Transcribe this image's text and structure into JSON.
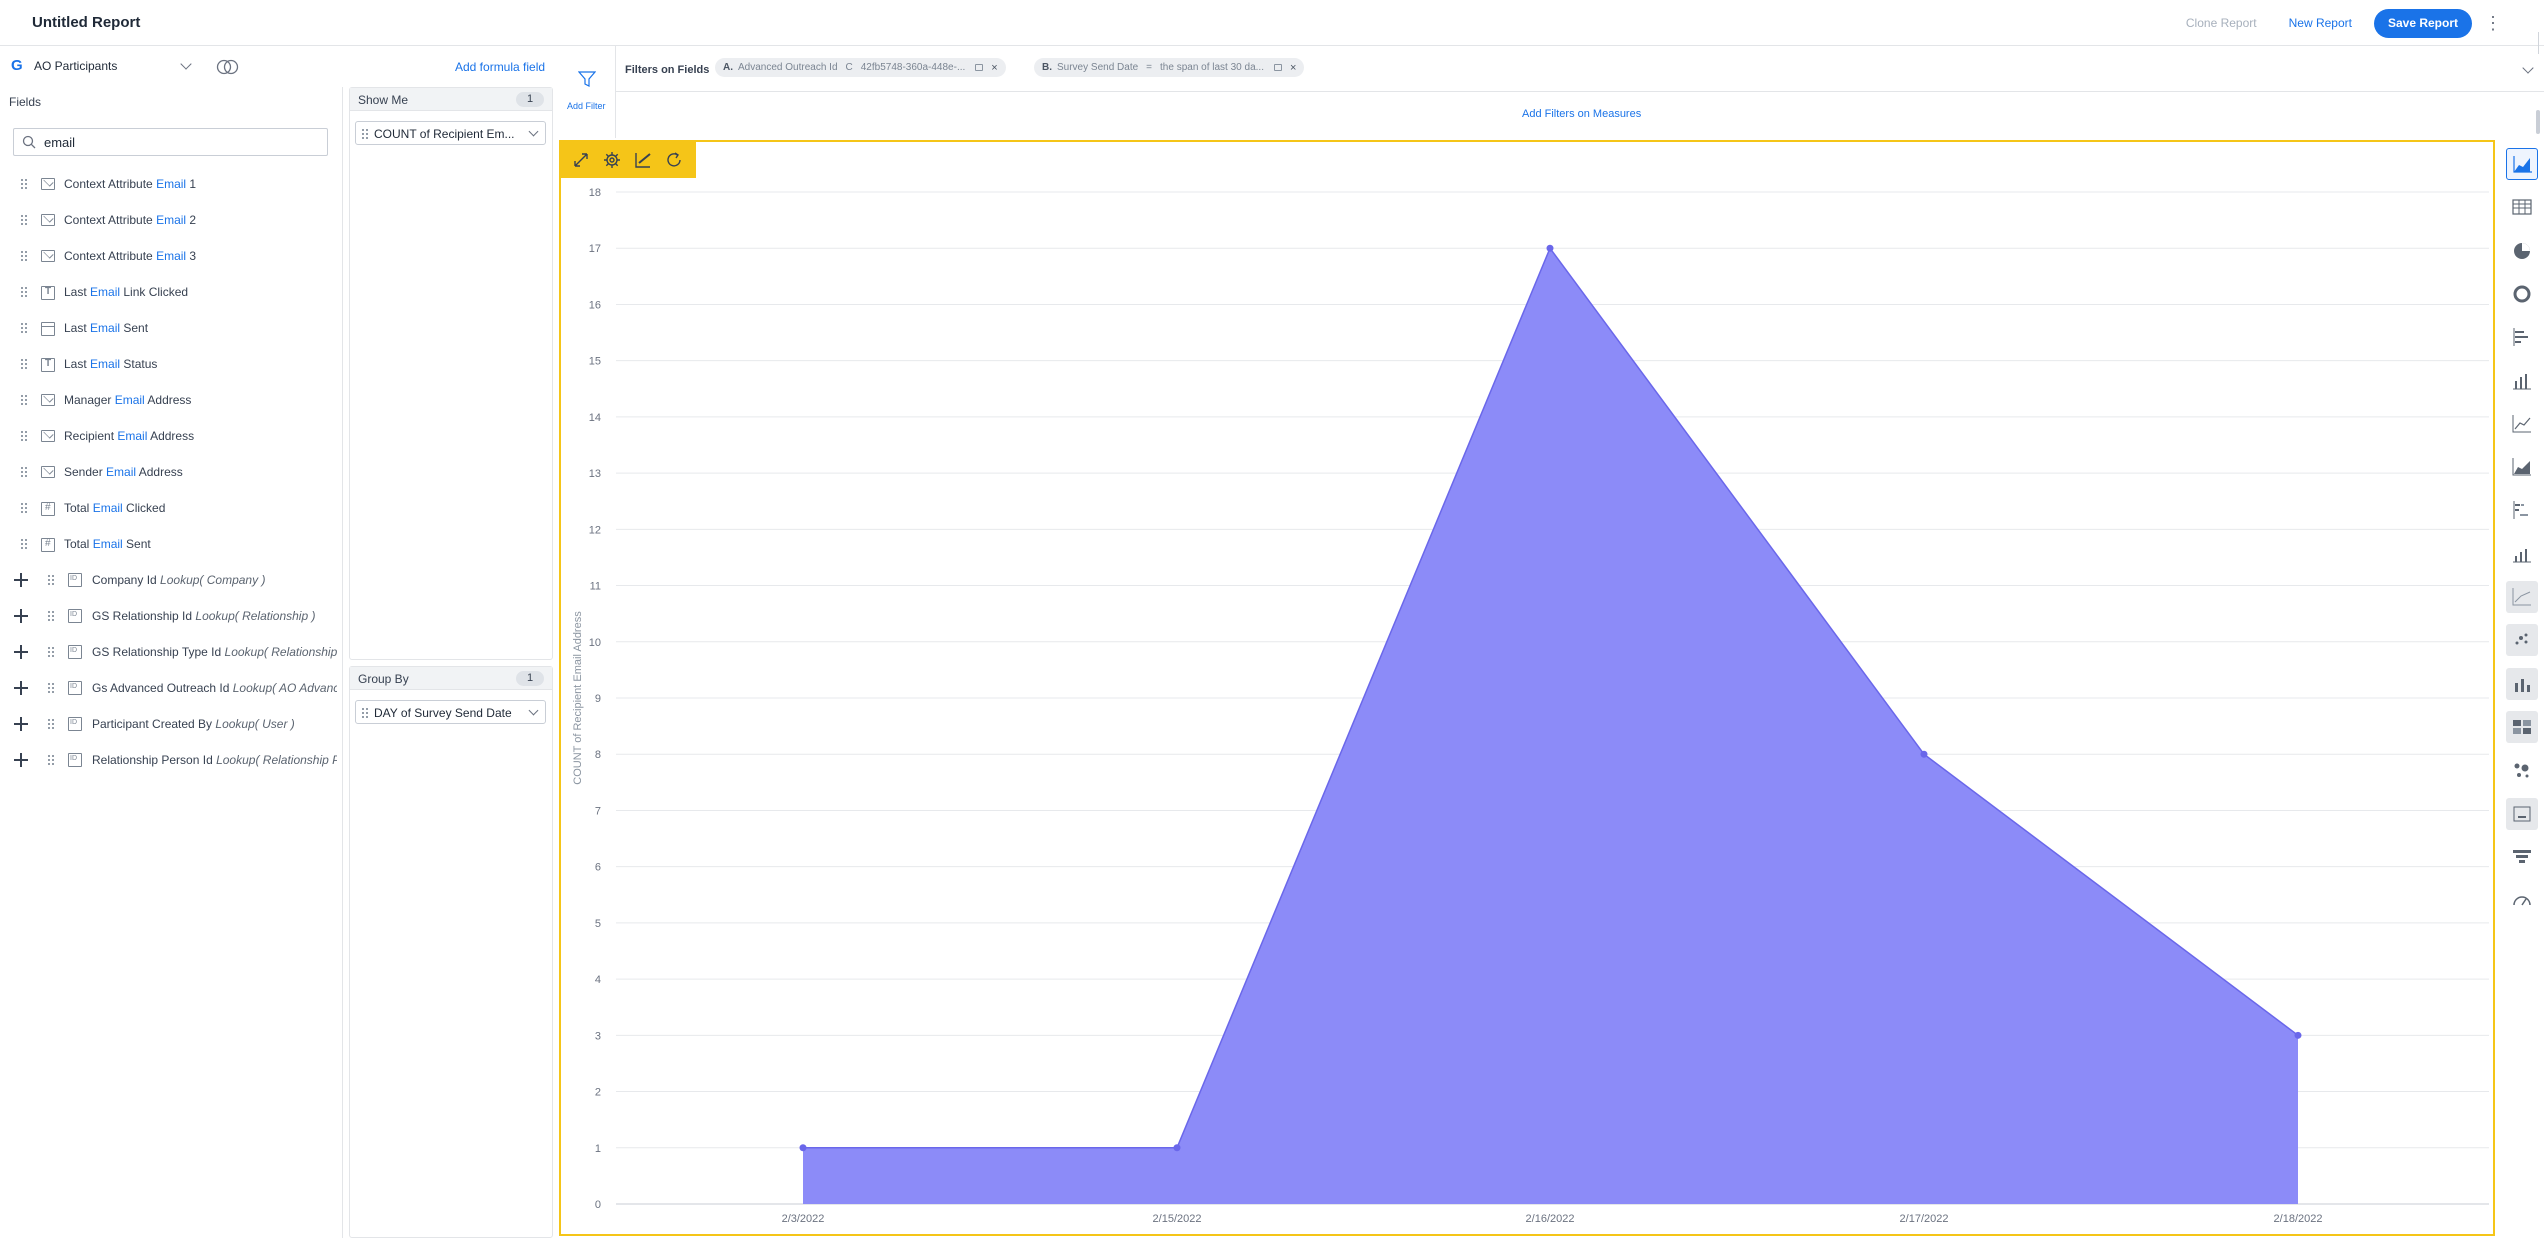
{
  "header": {
    "title": "Untitled Report",
    "clone_label": "Clone Report",
    "new_label": "New Report",
    "save_label": "Save Report"
  },
  "source": {
    "logo": "G",
    "object": "AO Participants",
    "add_formula_label": "Add formula field"
  },
  "fields_panel": {
    "header": "Fields",
    "search_value": "email",
    "items": [
      {
        "before": "Context Attribute ",
        "match": "Email",
        "after": " 1",
        "icon": "email-icon"
      },
      {
        "before": "Context Attribute ",
        "match": "Email",
        "after": " 2",
        "icon": "email-icon"
      },
      {
        "before": "Context Attribute ",
        "match": "Email",
        "after": " 3",
        "icon": "email-icon"
      },
      {
        "before": "Last ",
        "match": "Email",
        "after": " Link Clicked",
        "icon": "text-icon"
      },
      {
        "before": "Last ",
        "match": "Email",
        "after": " Sent",
        "icon": "calendar-icon"
      },
      {
        "before": "Last ",
        "match": "Email",
        "after": " Status",
        "icon": "text-icon"
      },
      {
        "before": "Manager ",
        "match": "Email",
        "after": " Address",
        "icon": "email-icon"
      },
      {
        "before": "Recipient ",
        "match": "Email",
        "after": " Address",
        "icon": "email-icon"
      },
      {
        "before": "Sender ",
        "match": "Email",
        "after": " Address",
        "icon": "email-icon"
      },
      {
        "before": "Total ",
        "match": "Email",
        "after": " Clicked",
        "icon": "number-icon"
      },
      {
        "before": "Total ",
        "match": "Email",
        "after": " Sent",
        "icon": "number-icon"
      }
    ],
    "lookups": [
      {
        "name": "Company Id ",
        "lookup": "Lookup( Company )"
      },
      {
        "name": "GS Relationship Id ",
        "lookup": "Lookup( Relationship )"
      },
      {
        "name": "GS Relationship Type Id ",
        "lookup": "Lookup( Relationship Ty"
      },
      {
        "name": "Gs Advanced Outreach Id ",
        "lookup": "Lookup( AO Advanced"
      },
      {
        "name": "Participant Created By ",
        "lookup": "Lookup( User )"
      },
      {
        "name": "Relationship Person Id ",
        "lookup": "Lookup( Relationship Per"
      }
    ]
  },
  "show_me": {
    "title": "Show Me",
    "count": "1",
    "pill": "COUNT of Recipient Em..."
  },
  "group_by": {
    "title": "Group By",
    "count": "1",
    "pill": "DAY of Survey Send Date"
  },
  "filters": {
    "add_filter_label": "Add Filter",
    "section_label": "Filters on Fields",
    "chips": [
      {
        "letter": "A.",
        "field": "Advanced Outreach Id",
        "op": "C",
        "value": "42fb5748-360a-448e-..."
      },
      {
        "letter": "B.",
        "field": "Survey Send Date",
        "op": "=",
        "value": "the span of last 30 da..."
      }
    ],
    "measures_label": "Add Filters on Measures"
  },
  "chart_data": {
    "type": "area",
    "categories": [
      "2/3/2022",
      "2/15/2022",
      "2/16/2022",
      "2/17/2022",
      "2/18/2022"
    ],
    "series": [
      {
        "values": [
          1,
          1,
          17,
          8,
          3
        ]
      }
    ],
    "ylabel": "COUNT of Recipient Email Address",
    "xlabel": "",
    "ylim": [
      0,
      18
    ],
    "yticks": [
      0,
      1,
      2,
      3,
      4,
      5,
      6,
      7,
      8,
      9,
      10,
      11,
      12,
      13,
      14,
      15,
      16,
      17,
      18
    ],
    "grid": true,
    "fill_color": "#8c8bf8",
    "line_color": "#6a67ea"
  },
  "chart_types": [
    "area-chart-icon",
    "table-icon",
    "pie-chart-icon",
    "donut-chart-icon",
    "bar-chart-icon",
    "column-chart-icon",
    "line-chart-icon",
    "stacked-area-icon",
    "stacked-bar-icon",
    "stacked-column-icon",
    "combo-line-icon",
    "scatter-icon",
    "column-line-icon",
    "heatmap-icon",
    "bubble-icon",
    "kpi-icon",
    "funnel-icon",
    "gauge-icon"
  ],
  "colors": {
    "accent": "#1a73e8",
    "chart_highlight": "#f5c518"
  }
}
